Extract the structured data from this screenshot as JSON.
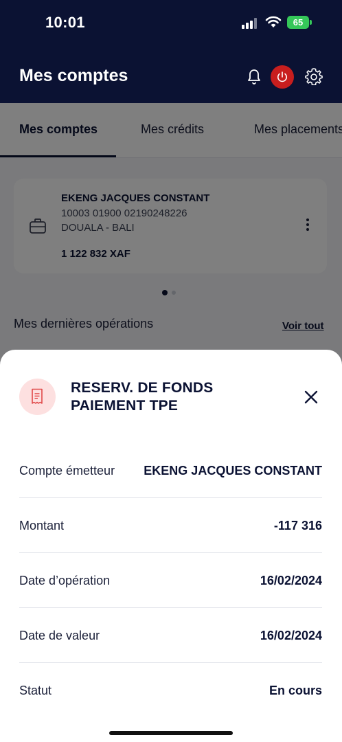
{
  "status_bar": {
    "time": "10:01",
    "battery": "65"
  },
  "header": {
    "title": "Mes comptes"
  },
  "tabs": [
    {
      "label": "Mes comptes"
    },
    {
      "label": "Mes crédits"
    },
    {
      "label": "Mes placements"
    }
  ],
  "account": {
    "name": "EKENG JACQUES CONSTANT",
    "number": "10003 01900 02190248226",
    "branch": "DOUALA - BALI",
    "balance": "1 122 832 XAF"
  },
  "operations": {
    "title": "Mes dernières opérations",
    "see_all": "Voir tout"
  },
  "sheet": {
    "title_line1": "RESERV. DE FONDS",
    "title_line2": "PAIEMENT TPE",
    "rows": [
      {
        "label": "Compte émetteur",
        "value": "EKENG JACQUES CONSTANT"
      },
      {
        "label": "Montant",
        "value": "-117 316"
      },
      {
        "label": "Date d’opération",
        "value": "16/02/2024"
      },
      {
        "label": "Date de valeur",
        "value": "16/02/2024"
      },
      {
        "label": "Statut",
        "value": "En cours"
      }
    ]
  },
  "colors": {
    "navy": "#0b1233",
    "danger": "#c81e1e",
    "battery": "#35c759",
    "icon_bg": "#fde0e0"
  }
}
